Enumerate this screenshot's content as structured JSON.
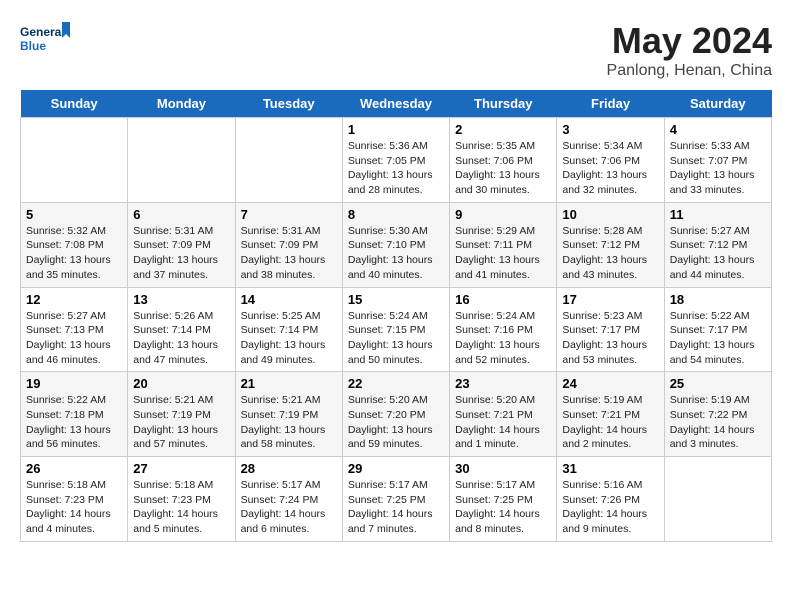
{
  "header": {
    "logo_line1": "General",
    "logo_line2": "Blue",
    "month": "May 2024",
    "location": "Panlong, Henan, China"
  },
  "weekdays": [
    "Sunday",
    "Monday",
    "Tuesday",
    "Wednesday",
    "Thursday",
    "Friday",
    "Saturday"
  ],
  "weeks": [
    [
      {
        "day": "",
        "content": ""
      },
      {
        "day": "",
        "content": ""
      },
      {
        "day": "",
        "content": ""
      },
      {
        "day": "1",
        "content": "Sunrise: 5:36 AM\nSunset: 7:05 PM\nDaylight: 13 hours\nand 28 minutes."
      },
      {
        "day": "2",
        "content": "Sunrise: 5:35 AM\nSunset: 7:06 PM\nDaylight: 13 hours\nand 30 minutes."
      },
      {
        "day": "3",
        "content": "Sunrise: 5:34 AM\nSunset: 7:06 PM\nDaylight: 13 hours\nand 32 minutes."
      },
      {
        "day": "4",
        "content": "Sunrise: 5:33 AM\nSunset: 7:07 PM\nDaylight: 13 hours\nand 33 minutes."
      }
    ],
    [
      {
        "day": "5",
        "content": "Sunrise: 5:32 AM\nSunset: 7:08 PM\nDaylight: 13 hours\nand 35 minutes."
      },
      {
        "day": "6",
        "content": "Sunrise: 5:31 AM\nSunset: 7:09 PM\nDaylight: 13 hours\nand 37 minutes."
      },
      {
        "day": "7",
        "content": "Sunrise: 5:31 AM\nSunset: 7:09 PM\nDaylight: 13 hours\nand 38 minutes."
      },
      {
        "day": "8",
        "content": "Sunrise: 5:30 AM\nSunset: 7:10 PM\nDaylight: 13 hours\nand 40 minutes."
      },
      {
        "day": "9",
        "content": "Sunrise: 5:29 AM\nSunset: 7:11 PM\nDaylight: 13 hours\nand 41 minutes."
      },
      {
        "day": "10",
        "content": "Sunrise: 5:28 AM\nSunset: 7:12 PM\nDaylight: 13 hours\nand 43 minutes."
      },
      {
        "day": "11",
        "content": "Sunrise: 5:27 AM\nSunset: 7:12 PM\nDaylight: 13 hours\nand 44 minutes."
      }
    ],
    [
      {
        "day": "12",
        "content": "Sunrise: 5:27 AM\nSunset: 7:13 PM\nDaylight: 13 hours\nand 46 minutes."
      },
      {
        "day": "13",
        "content": "Sunrise: 5:26 AM\nSunset: 7:14 PM\nDaylight: 13 hours\nand 47 minutes."
      },
      {
        "day": "14",
        "content": "Sunrise: 5:25 AM\nSunset: 7:14 PM\nDaylight: 13 hours\nand 49 minutes."
      },
      {
        "day": "15",
        "content": "Sunrise: 5:24 AM\nSunset: 7:15 PM\nDaylight: 13 hours\nand 50 minutes."
      },
      {
        "day": "16",
        "content": "Sunrise: 5:24 AM\nSunset: 7:16 PM\nDaylight: 13 hours\nand 52 minutes."
      },
      {
        "day": "17",
        "content": "Sunrise: 5:23 AM\nSunset: 7:17 PM\nDaylight: 13 hours\nand 53 minutes."
      },
      {
        "day": "18",
        "content": "Sunrise: 5:22 AM\nSunset: 7:17 PM\nDaylight: 13 hours\nand 54 minutes."
      }
    ],
    [
      {
        "day": "19",
        "content": "Sunrise: 5:22 AM\nSunset: 7:18 PM\nDaylight: 13 hours\nand 56 minutes."
      },
      {
        "day": "20",
        "content": "Sunrise: 5:21 AM\nSunset: 7:19 PM\nDaylight: 13 hours\nand 57 minutes."
      },
      {
        "day": "21",
        "content": "Sunrise: 5:21 AM\nSunset: 7:19 PM\nDaylight: 13 hours\nand 58 minutes."
      },
      {
        "day": "22",
        "content": "Sunrise: 5:20 AM\nSunset: 7:20 PM\nDaylight: 13 hours\nand 59 minutes."
      },
      {
        "day": "23",
        "content": "Sunrise: 5:20 AM\nSunset: 7:21 PM\nDaylight: 14 hours\nand 1 minute."
      },
      {
        "day": "24",
        "content": "Sunrise: 5:19 AM\nSunset: 7:21 PM\nDaylight: 14 hours\nand 2 minutes."
      },
      {
        "day": "25",
        "content": "Sunrise: 5:19 AM\nSunset: 7:22 PM\nDaylight: 14 hours\nand 3 minutes."
      }
    ],
    [
      {
        "day": "26",
        "content": "Sunrise: 5:18 AM\nSunset: 7:23 PM\nDaylight: 14 hours\nand 4 minutes."
      },
      {
        "day": "27",
        "content": "Sunrise: 5:18 AM\nSunset: 7:23 PM\nDaylight: 14 hours\nand 5 minutes."
      },
      {
        "day": "28",
        "content": "Sunrise: 5:17 AM\nSunset: 7:24 PM\nDaylight: 14 hours\nand 6 minutes."
      },
      {
        "day": "29",
        "content": "Sunrise: 5:17 AM\nSunset: 7:25 PM\nDaylight: 14 hours\nand 7 minutes."
      },
      {
        "day": "30",
        "content": "Sunrise: 5:17 AM\nSunset: 7:25 PM\nDaylight: 14 hours\nand 8 minutes."
      },
      {
        "day": "31",
        "content": "Sunrise: 5:16 AM\nSunset: 7:26 PM\nDaylight: 14 hours\nand 9 minutes."
      },
      {
        "day": "",
        "content": ""
      }
    ]
  ]
}
